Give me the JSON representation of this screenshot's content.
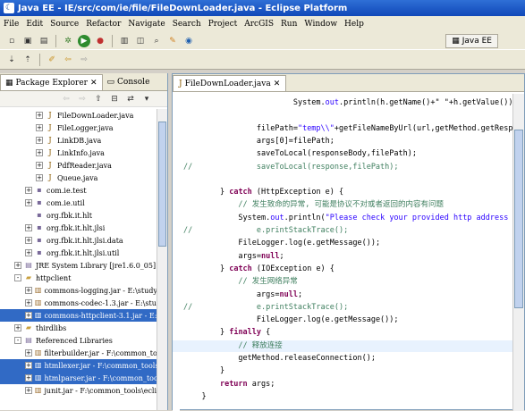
{
  "window": {
    "title": "Java EE - IE/src/com/ie/file/FileDownLoader.java - Eclipse Platform"
  },
  "menu": [
    "File",
    "Edit",
    "Source",
    "Refactor",
    "Navigate",
    "Search",
    "Project",
    "ArcGIS",
    "Run",
    "Window",
    "Help"
  ],
  "perspective": {
    "label": "Java EE"
  },
  "left_tabs": [
    {
      "label": "Package Explorer",
      "active": true
    },
    {
      "label": "Console",
      "active": false
    }
  ],
  "tree": [
    {
      "indent": 3,
      "expander": "+",
      "icon": "java-file-icon",
      "glyph": "J",
      "label": "FileDownLoader.java",
      "selected": false
    },
    {
      "indent": 3,
      "expander": "+",
      "icon": "java-file-icon",
      "glyph": "J",
      "label": "FileLogger.java",
      "selected": false
    },
    {
      "indent": 3,
      "expander": "+",
      "icon": "java-file-icon",
      "glyph": "J",
      "label": "LinkDB.java",
      "selected": false
    },
    {
      "indent": 3,
      "expander": "+",
      "icon": "java-file-icon",
      "glyph": "J",
      "label": "LinkInfo.java",
      "selected": false
    },
    {
      "indent": 3,
      "expander": "+",
      "icon": "java-file-icon",
      "glyph": "J",
      "label": "PdfReader.java",
      "selected": false
    },
    {
      "indent": 3,
      "expander": "+",
      "icon": "java-file-icon",
      "glyph": "J",
      "label": "Queue.java",
      "selected": false
    },
    {
      "indent": 2,
      "expander": "+",
      "icon": "package-icon",
      "glyph": "▪",
      "label": "com.ie.test",
      "selected": false
    },
    {
      "indent": 2,
      "expander": "+",
      "icon": "package-icon",
      "glyph": "▪",
      "label": "com.ie.util",
      "selected": false
    },
    {
      "indent": 2,
      "expander": "",
      "icon": "package-icon",
      "glyph": "▪",
      "label": "org.fbk.it.hlt",
      "selected": false
    },
    {
      "indent": 2,
      "expander": "+",
      "icon": "package-icon",
      "glyph": "▪",
      "label": "org.fbk.it.hlt.jlsi",
      "selected": false
    },
    {
      "indent": 2,
      "expander": "+",
      "icon": "package-icon",
      "glyph": "▪",
      "label": "org.fbk.it.hlt.jlsi.data",
      "selected": false
    },
    {
      "indent": 2,
      "expander": "+",
      "icon": "package-icon",
      "glyph": "▪",
      "label": "org.fbk.it.hlt.jlsi.util",
      "selected": false
    },
    {
      "indent": 1,
      "expander": "+",
      "icon": "library-icon",
      "glyph": "▤",
      "label": "JRE System Library [jre1.6.0_05]",
      "selected": false
    },
    {
      "indent": 1,
      "expander": "-",
      "icon": "folder-icon",
      "glyph": "▰",
      "label": "httpclient",
      "selected": false
    },
    {
      "indent": 2,
      "expander": "+",
      "icon": "jar-icon",
      "glyph": "▥",
      "label": "commons-logging.jar - E:\\study\\proj",
      "selected": false
    },
    {
      "indent": 2,
      "expander": "+",
      "icon": "jar-icon",
      "glyph": "▥",
      "label": "commons-codec-1.3.jar - E:\\study\\pr",
      "selected": false
    },
    {
      "indent": 2,
      "expander": "+",
      "icon": "jar-icon",
      "glyph": "▥",
      "label": "commons-httpclient-3.1.jar - E:\\stu",
      "selected": true
    },
    {
      "indent": 1,
      "expander": "+",
      "icon": "folder-icon",
      "glyph": "▰",
      "label": "thirdlibs",
      "selected": false
    },
    {
      "indent": 1,
      "expander": "-",
      "icon": "library-icon",
      "glyph": "▤",
      "label": "Referenced Libraries",
      "selected": false
    },
    {
      "indent": 2,
      "expander": "+",
      "icon": "jar-icon",
      "glyph": "▥",
      "label": "filterbuilder.jar - F:\\common_tools",
      "selected": false
    },
    {
      "indent": 2,
      "expander": "+",
      "icon": "jar-icon",
      "glyph": "▥",
      "label": "htmllexer.jar - F:\\common_tools\\ec",
      "selected": true
    },
    {
      "indent": 2,
      "expander": "+",
      "icon": "jar-icon",
      "glyph": "▥",
      "label": "htmlparser.jar - F:\\common_tools\\ec",
      "selected": true
    },
    {
      "indent": 2,
      "expander": "+",
      "icon": "jar-icon",
      "glyph": "▥",
      "label": "junit.jar - F:\\common_tools\\eclipse",
      "selected": false
    }
  ],
  "editor": {
    "tab_label": "FileDownLoader.java",
    "lines": [
      {
        "indent": 24,
        "parts": [
          {
            "t": "System.",
            "c": ""
          },
          {
            "t": "out",
            "c": "str"
          },
          {
            "t": ".println(h.getName()+\" \"+h.getValue());*/",
            "c": ""
          }
        ]
      },
      {
        "indent": 0,
        "parts": []
      },
      {
        "indent": 16,
        "parts": [
          {
            "t": "filePath=",
            "c": ""
          },
          {
            "t": "\"temp\\\\\"",
            "c": "str"
          },
          {
            "t": "+getFileNameByUrl(url,getMethod.getResponse",
            "c": ""
          }
        ]
      },
      {
        "indent": 16,
        "parts": [
          {
            "t": "args[0]=filePath;",
            "c": ""
          }
        ]
      },
      {
        "indent": 16,
        "parts": [
          {
            "t": "saveToLocal(responseBody,filePath);",
            "c": ""
          }
        ]
      },
      {
        "indent": 0,
        "parts": [
          {
            "t": "//              saveToLocal(response,filePath);",
            "c": "cm"
          }
        ]
      },
      {
        "indent": 0,
        "parts": []
      },
      {
        "indent": 8,
        "parts": [
          {
            "t": "} ",
            "c": ""
          },
          {
            "t": "catch",
            "c": "kw"
          },
          {
            "t": " (HttpException e) {",
            "c": ""
          }
        ]
      },
      {
        "indent": 12,
        "parts": [
          {
            "t": "// 发生致命的异常, 可能是协议不对或者返回的内容有问题",
            "c": "cm"
          }
        ]
      },
      {
        "indent": 12,
        "parts": [
          {
            "t": "System.",
            "c": ""
          },
          {
            "t": "out",
            "c": "str"
          },
          {
            "t": ".println(",
            "c": ""
          },
          {
            "t": "\"Please check your provided http address",
            "c": "str"
          }
        ]
      },
      {
        "indent": 0,
        "parts": [
          {
            "t": "//              e.printStackTrace();",
            "c": "cm"
          }
        ]
      },
      {
        "indent": 12,
        "parts": [
          {
            "t": "FileLogger.log(e.getMessage());",
            "c": ""
          }
        ]
      },
      {
        "indent": 12,
        "parts": [
          {
            "t": "args=",
            "c": ""
          },
          {
            "t": "null",
            "c": "kw"
          },
          {
            "t": ";",
            "c": ""
          }
        ]
      },
      {
        "indent": 8,
        "parts": [
          {
            "t": "} ",
            "c": ""
          },
          {
            "t": "catch",
            "c": "kw"
          },
          {
            "t": " (IOException e) {",
            "c": ""
          }
        ]
      },
      {
        "indent": 12,
        "parts": [
          {
            "t": "// 发生网络异常",
            "c": "cm"
          }
        ]
      },
      {
        "indent": 16,
        "parts": [
          {
            "t": "args=",
            "c": ""
          },
          {
            "t": "null",
            "c": "kw"
          },
          {
            "t": ";",
            "c": ""
          }
        ]
      },
      {
        "indent": 0,
        "parts": [
          {
            "t": "//              e.printStackTrace();",
            "c": "cm"
          }
        ]
      },
      {
        "indent": 16,
        "parts": [
          {
            "t": "FileLogger.log(e.getMessage());",
            "c": ""
          }
        ]
      },
      {
        "indent": 8,
        "parts": [
          {
            "t": "} ",
            "c": ""
          },
          {
            "t": "finally",
            "c": "kw"
          },
          {
            "t": " {",
            "c": ""
          }
        ]
      },
      {
        "indent": 12,
        "parts": [
          {
            "t": "// 释放连接",
            "c": "cm"
          }
        ],
        "highlight": true
      },
      {
        "indent": 12,
        "parts": [
          {
            "t": "getMethod.releaseConnection();",
            "c": ""
          }
        ]
      },
      {
        "indent": 8,
        "parts": [
          {
            "t": "}",
            "c": ""
          }
        ]
      },
      {
        "indent": 8,
        "parts": [
          {
            "t": "return",
            "c": "kw"
          },
          {
            "t": " args;",
            "c": ""
          }
        ]
      },
      {
        "indent": 4,
        "parts": [
          {
            "t": "}",
            "c": ""
          }
        ]
      }
    ]
  },
  "colors": {
    "title_bar": "#1048b8",
    "selection": "#316ac5",
    "keyword": "#7f0055",
    "string": "#2a00ff",
    "comment": "#3f7f5f"
  }
}
